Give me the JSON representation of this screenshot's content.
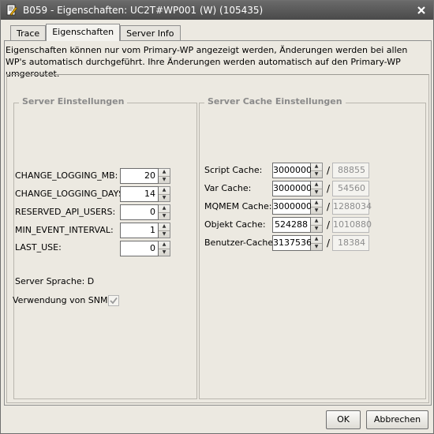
{
  "window": {
    "title": "B059 - Eigenschaften: UC2T#WP001 (W) (105435)"
  },
  "tabs": [
    {
      "label": "Trace"
    },
    {
      "label": "Eigenschaften"
    },
    {
      "label": "Server Info"
    }
  ],
  "info_text": "Eigenschaften können nur vom Primary-WP angezeigt werden, Änderungen werden bei allen WP's automatisch durchgeführt. Ihre Änderungen werden automatisch auf den Primary-WP umgeroutet.",
  "server_settings": {
    "title": "Server Einstellungen",
    "fields": [
      {
        "label": "CHANGE_LOGGING_MB:",
        "value": "20"
      },
      {
        "label": "CHANGE_LOGGING_DAYS:",
        "value": "14"
      },
      {
        "label": "RESERVED_API_USERS:",
        "value": "0"
      },
      {
        "label": "MIN_EVENT_INTERVAL:",
        "value": "1"
      },
      {
        "label": "LAST_USE:",
        "value": "0"
      }
    ],
    "language": "Server Sprache: D",
    "snmp_label": "Verwendung von SNMP",
    "snmp_checked": true
  },
  "cache_settings": {
    "title": "Server Cache Einstellungen",
    "separator": "/",
    "fields": [
      {
        "label": "Script Cache:",
        "value": "3000000",
        "current": "88855"
      },
      {
        "label": "Var Cache:",
        "value": "3000000",
        "current": "54560"
      },
      {
        "label": "MQMEM Cache:",
        "value": "3000000",
        "current": "1288034"
      },
      {
        "label": "Objekt Cache:",
        "value": "524288",
        "current": "1010880"
      },
      {
        "label": "Benutzer-Cache:",
        "value": "3137536",
        "current": "18384"
      }
    ]
  },
  "buttons": {
    "ok": "OK",
    "cancel": "Abbrechen"
  }
}
